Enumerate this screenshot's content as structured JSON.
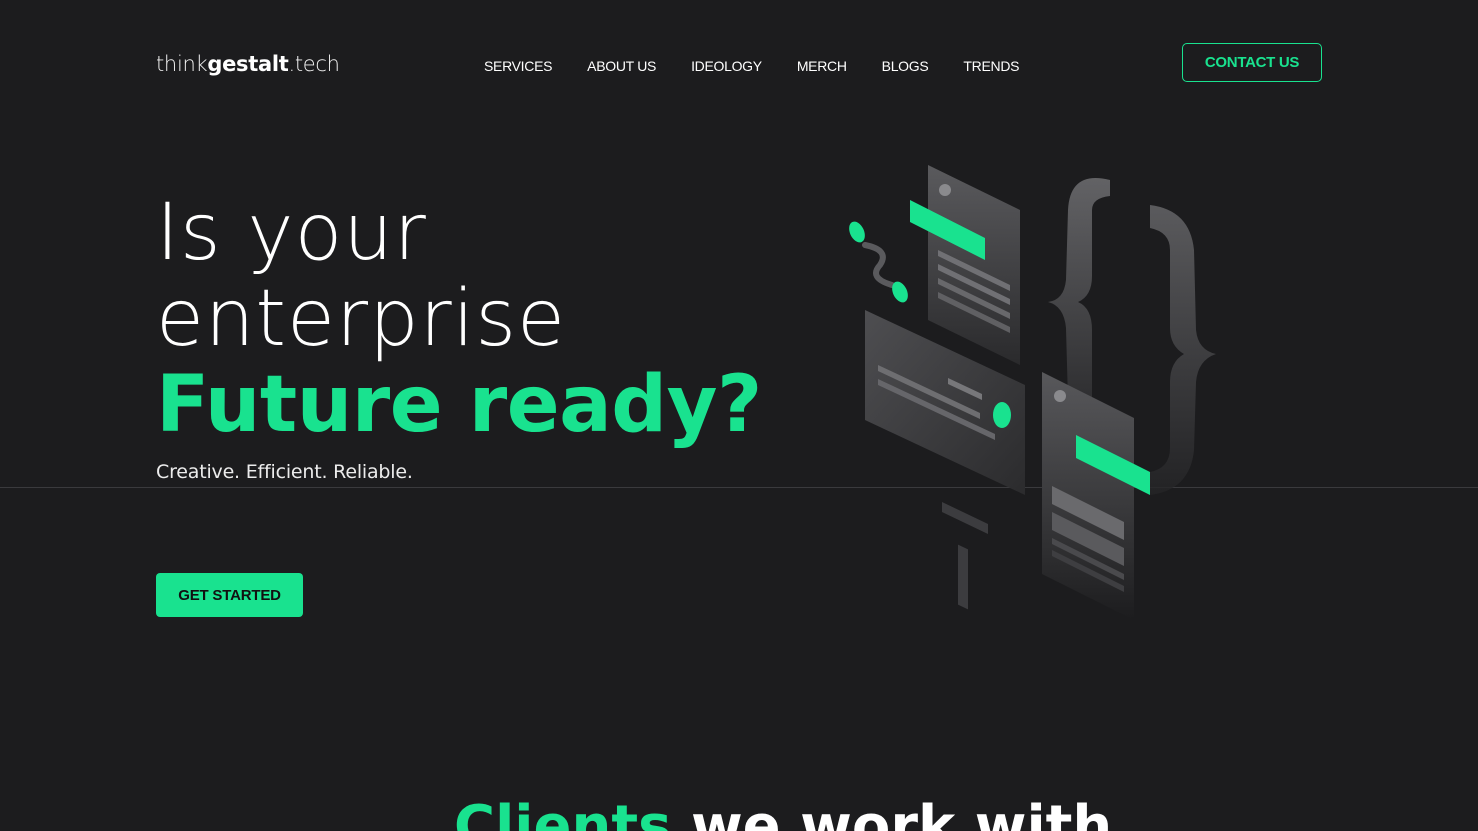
{
  "header": {
    "logo": {
      "prefix": "think",
      "name": "gestalt",
      "suffix": ".tech"
    },
    "nav": [
      "SERVICES",
      "ABOUT US",
      "IDEOLOGY",
      "MERCH",
      "BLOGS",
      "TRENDS"
    ],
    "contact_label": "CONTACT US"
  },
  "hero": {
    "title_line1": "Is your",
    "title_line2": "enterprise",
    "title_accent": "Future ready?",
    "tagline": "Creative. Efficient. Reliable.",
    "cta_label": "GET STARTED"
  },
  "clients": {
    "heading_accent": "Clients",
    "heading_rest": "we work with"
  },
  "colors": {
    "background": "#1c1c1e",
    "accent": "#19e28f",
    "text": "#ffffff"
  },
  "illustration": {
    "icons": [
      "code-braces-icon",
      "chat-bubble-icon",
      "document-card-icon",
      "plus-icon",
      "link-chain-icon"
    ]
  }
}
